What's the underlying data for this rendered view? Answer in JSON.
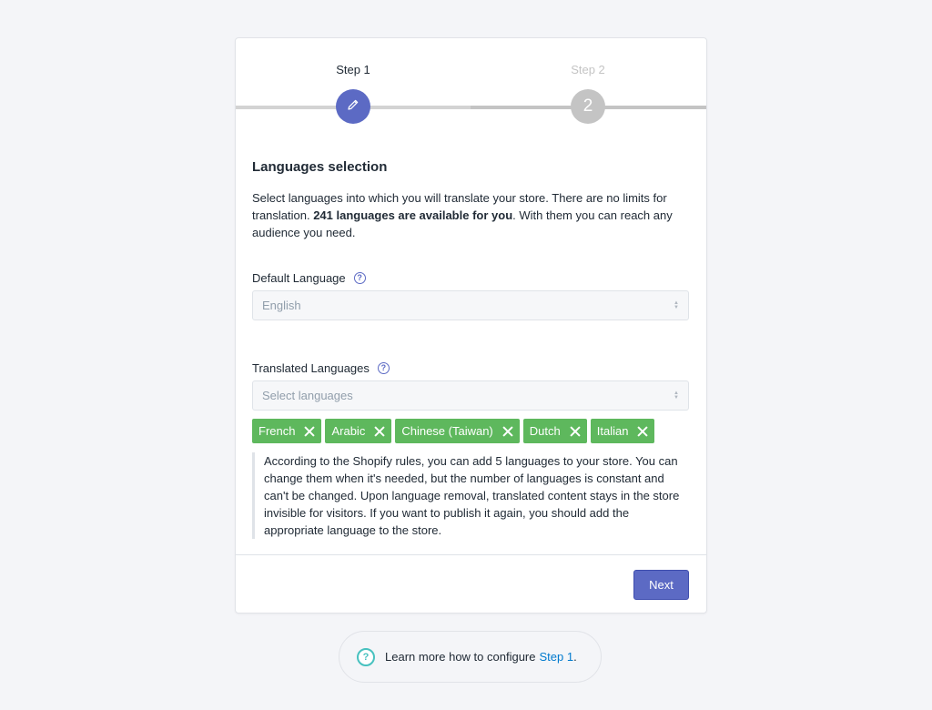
{
  "stepper": {
    "steps": [
      {
        "label": "Step 1",
        "state": "active",
        "icon": "pencil-icon"
      },
      {
        "label": "Step 2",
        "state": "inactive",
        "number": "2"
      }
    ],
    "colors": {
      "active": "#5c6ac4",
      "inactive": "#c4c4c4"
    }
  },
  "section": {
    "title": "Languages selection",
    "intro_before": "Select languages into which you will translate your store. There are no limits for translation. ",
    "intro_bold": "241 languages are available for you",
    "intro_after": ". With them you can reach any audience you need."
  },
  "default_language": {
    "label": "Default Language",
    "value": "English",
    "help_icon": "question-circle-icon"
  },
  "translated_languages": {
    "label": "Translated Languages",
    "placeholder": "Select languages",
    "help_icon": "question-circle-icon",
    "selected": [
      "French",
      "Arabic",
      "Chinese (Taiwan)",
      "Dutch",
      "Italian"
    ],
    "tag_color": "#5eb85d"
  },
  "note": "According to the Shopify rules, you can add 5 languages to your store. You can change them when it's needed, but the number of languages is constant and can't be changed. Upon language removal, translated content stays in the store invisible for visitors. If you want to publish it again, you should add the appropriate language to the store.",
  "footer": {
    "next_label": "Next",
    "accent": "#5c6ac4"
  },
  "help": {
    "text": "Learn more how to configure",
    "link": "Step 1",
    "suffix": ".",
    "icon": "question-circle-icon"
  }
}
